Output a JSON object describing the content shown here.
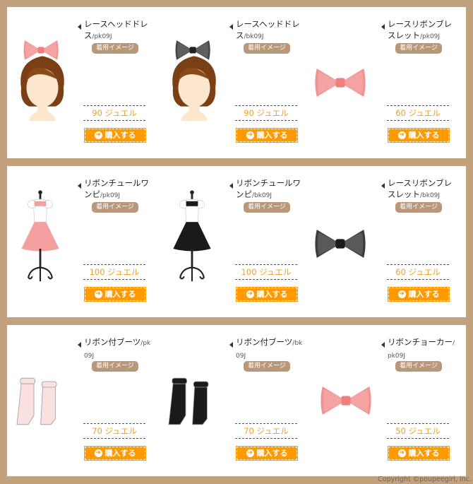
{
  "colors": {
    "background": "#c1a27d",
    "panel": "#ffffff",
    "badge": "#b9987a",
    "price_text": "#f0a028",
    "buy_button": "#ff9a00"
  },
  "rows": [
    {
      "items": [
        {
          "name": "レースヘッドドレス",
          "code": "/pk09J",
          "badge": "着用イメージ",
          "price": "90 ジュエル",
          "buy": "購入する",
          "image": "lace-headdress-pink"
        },
        {
          "name": "レースヘッドドレス",
          "code": "/bk09J",
          "badge": "着用イメージ",
          "price": "90 ジュエル",
          "buy": "購入する",
          "image": "lace-headdress-black"
        },
        {
          "name": "レースリボンブレスレット",
          "code": "/pk09J",
          "badge": "着用イメージ",
          "price": "60 ジュエル",
          "buy": "購入する",
          "image": "ribbon-bracelet-pink"
        }
      ]
    },
    {
      "items": [
        {
          "name": "リボンチュールワンピ",
          "code": "/pk09J",
          "badge": "着用イメージ",
          "price": "100 ジュエル",
          "buy": "購入する",
          "image": "tulle-dress-pink"
        },
        {
          "name": "リボンチュールワンピ",
          "code": "/bk09J",
          "badge": "着用イメージ",
          "price": "100 ジュエル",
          "buy": "購入する",
          "image": "tulle-dress-black"
        },
        {
          "name": "レースリボンブレスレット",
          "code": "/bk09J",
          "badge": "着用イメージ",
          "price": "60 ジュエル",
          "buy": "購入する",
          "image": "ribbon-bracelet-black"
        }
      ]
    },
    {
      "items": [
        {
          "name": "リボン付ブーツ",
          "code": "/pk09J",
          "badge": "着用イメージ",
          "price": "70 ジュエル",
          "buy": "購入する",
          "image": "ribbon-boots-pink"
        },
        {
          "name": "リボン付ブーツ",
          "code": "/bk09J",
          "badge": "着用イメージ",
          "price": "70 ジュエル",
          "buy": "購入する",
          "image": "ribbon-boots-black"
        },
        {
          "name": "リボンチョーカー",
          "code": "/pk09J",
          "badge": "着用イメージ",
          "price": "50 ジュエル",
          "buy": "購入する",
          "image": "ribbon-choker-pink"
        }
      ]
    }
  ],
  "copyright": "Copyright ©poupeegirl, Inc."
}
